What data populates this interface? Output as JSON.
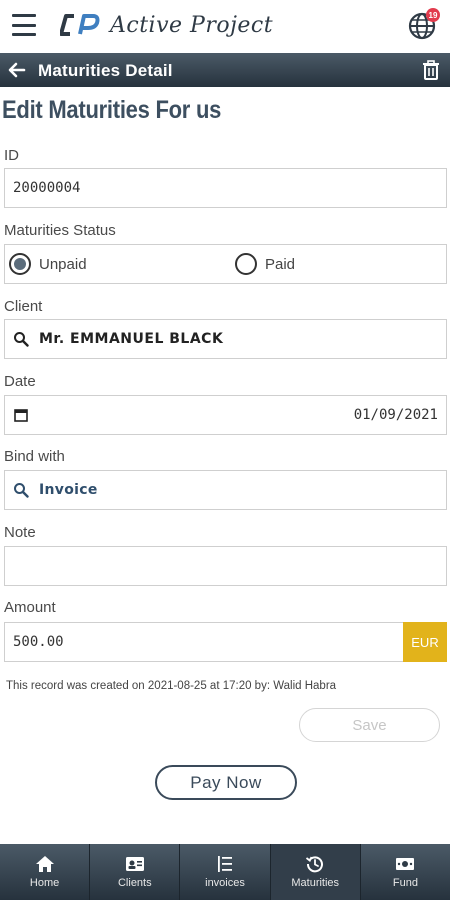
{
  "app": {
    "name": "Active Project",
    "notification_count": "19"
  },
  "header": {
    "title": "Maturities Detail"
  },
  "page": {
    "title": "Edit Maturities For us"
  },
  "form": {
    "id_label": "ID",
    "id_value": "20000004",
    "status_label": "Maturities Status",
    "status_options": [
      {
        "label": "Unpaid",
        "selected": true
      },
      {
        "label": "Paid",
        "selected": false
      }
    ],
    "client_label": "Client",
    "client_value": "Mr. EMMANUEL BLACK",
    "date_label": "Date",
    "date_value": "01/09/2021",
    "bind_label": "Bind with",
    "bind_value": "Invoice",
    "note_label": "Note",
    "note_value": "",
    "amount_label": "Amount",
    "amount_value": "500.00",
    "currency": "EUR",
    "meta": "This record was created on 2021-08-25 at 17:20 by: Walid Habra",
    "save_label": "Save",
    "pay_label": "Pay Now"
  },
  "nav": {
    "items": [
      {
        "label": "Home",
        "icon": "home-icon",
        "active": false
      },
      {
        "label": "Clients",
        "icon": "id-card-icon",
        "active": false
      },
      {
        "label": "invoices",
        "icon": "list-icon",
        "active": false
      },
      {
        "label": "Maturities",
        "icon": "history-icon",
        "active": true
      },
      {
        "label": "Fund",
        "icon": "banknote-icon",
        "active": false
      }
    ]
  },
  "colors": {
    "bar": "#2f3b46",
    "accent_currency": "#e2b31b",
    "badge": "#e23b4d"
  }
}
